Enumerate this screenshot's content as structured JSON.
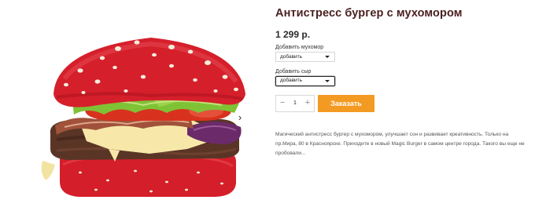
{
  "product": {
    "title": "Антистресс бургер с мухомором",
    "price": "1 299 р."
  },
  "options": [
    {
      "label": "Добавить мухомор",
      "selected": "добавить"
    },
    {
      "label": "Добавить сыр",
      "selected": "добавить"
    }
  ],
  "quantity": {
    "minus": "−",
    "value": "1",
    "plus": "+"
  },
  "order_button": {
    "label": "Заказать",
    "color": "#f39a22"
  },
  "description": "Магический антистресс бургер с мухомором, улучшает сон и развивает креативность. Только на пр.Мира, 80 в Красноярске. Приходите в новый Magic Burger в самом центре города. Такого вы еще не пробовали...",
  "gallery": {
    "next_icon": "chevron-right-icon"
  }
}
